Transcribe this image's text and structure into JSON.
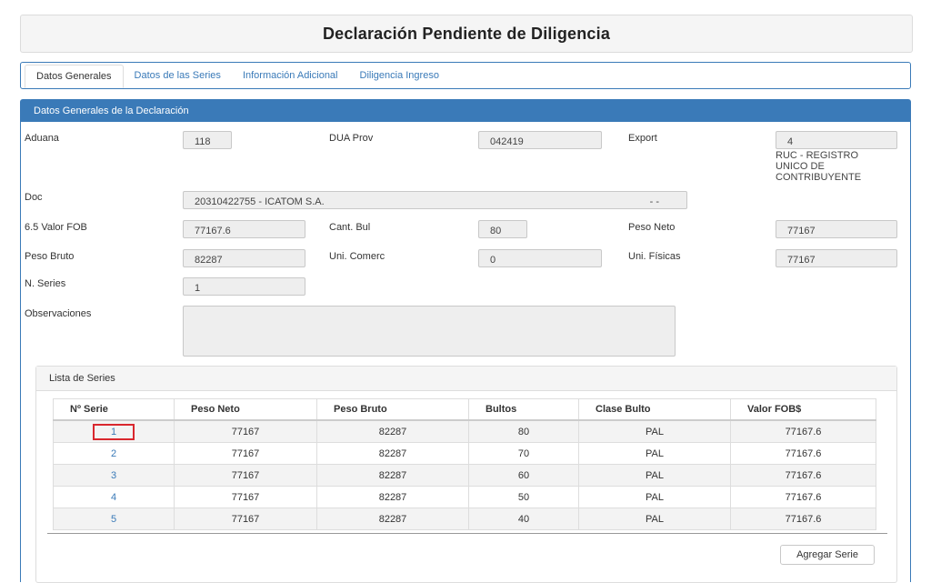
{
  "page_title": "Declaración Pendiente de Diligencia",
  "tabs": [
    {
      "label": "Datos Generales",
      "active": true
    },
    {
      "label": "Datos de las Series",
      "active": false
    },
    {
      "label": "Información Adicional",
      "active": false
    },
    {
      "label": "Diligencia Ingreso",
      "active": false
    }
  ],
  "panel_title": "Datos Generales de la Declaración",
  "fields": {
    "aduana": {
      "label": "Aduana",
      "value": "118"
    },
    "dua_prov": {
      "label": "DUA Prov",
      "value": "042419"
    },
    "export": {
      "label": "Export",
      "value_line1": "4",
      "value_line2": "RUC - REGISTRO",
      "value_line3": "UNICO DE",
      "value_line4": "CONTRIBUYENTE"
    },
    "doc": {
      "label": "Doc",
      "value": "20310422755 - ICATOM S.A.",
      "suffix": "- -"
    },
    "valor_fob": {
      "label": "6.5 Valor FOB",
      "value": "77167.6"
    },
    "cant_bul": {
      "label": "Cant. Bul",
      "value": "80"
    },
    "peso_neto": {
      "label": "Peso Neto",
      "value": "77167"
    },
    "peso_bruto": {
      "label": "Peso Bruto",
      "value": "82287"
    },
    "uni_comerc": {
      "label": "Uni. Comerc",
      "value": "0"
    },
    "uni_fisicas": {
      "label": "Uni. Físicas",
      "value": "77167"
    },
    "n_series": {
      "label": "N. Series",
      "value": "1"
    },
    "observaciones": {
      "label": "Observaciones",
      "value": ""
    }
  },
  "series": {
    "title": "Lista de Series",
    "columns": [
      "Nº Serie",
      "Peso Neto",
      "Peso Bruto",
      "Bultos",
      "Clase Bulto",
      "Valor FOB$"
    ],
    "rows": [
      {
        "serie": "1",
        "peso_neto": "77167",
        "peso_bruto": "82287",
        "bultos": "80",
        "clase": "PAL",
        "fob": "77167.6"
      },
      {
        "serie": "2",
        "peso_neto": "77167",
        "peso_bruto": "82287",
        "bultos": "70",
        "clase": "PAL",
        "fob": "77167.6"
      },
      {
        "serie": "3",
        "peso_neto": "77167",
        "peso_bruto": "82287",
        "bultos": "60",
        "clase": "PAL",
        "fob": "77167.6"
      },
      {
        "serie": "4",
        "peso_neto": "77167",
        "peso_bruto": "82287",
        "bultos": "50",
        "clase": "PAL",
        "fob": "77167.6"
      },
      {
        "serie": "5",
        "peso_neto": "77167",
        "peso_bruto": "82287",
        "bultos": "40",
        "clase": "PAL",
        "fob": "77167.6"
      }
    ],
    "add_button": "Agregar Serie"
  },
  "colors": {
    "accent": "#3a7ab8",
    "highlight": "#d9272e"
  }
}
